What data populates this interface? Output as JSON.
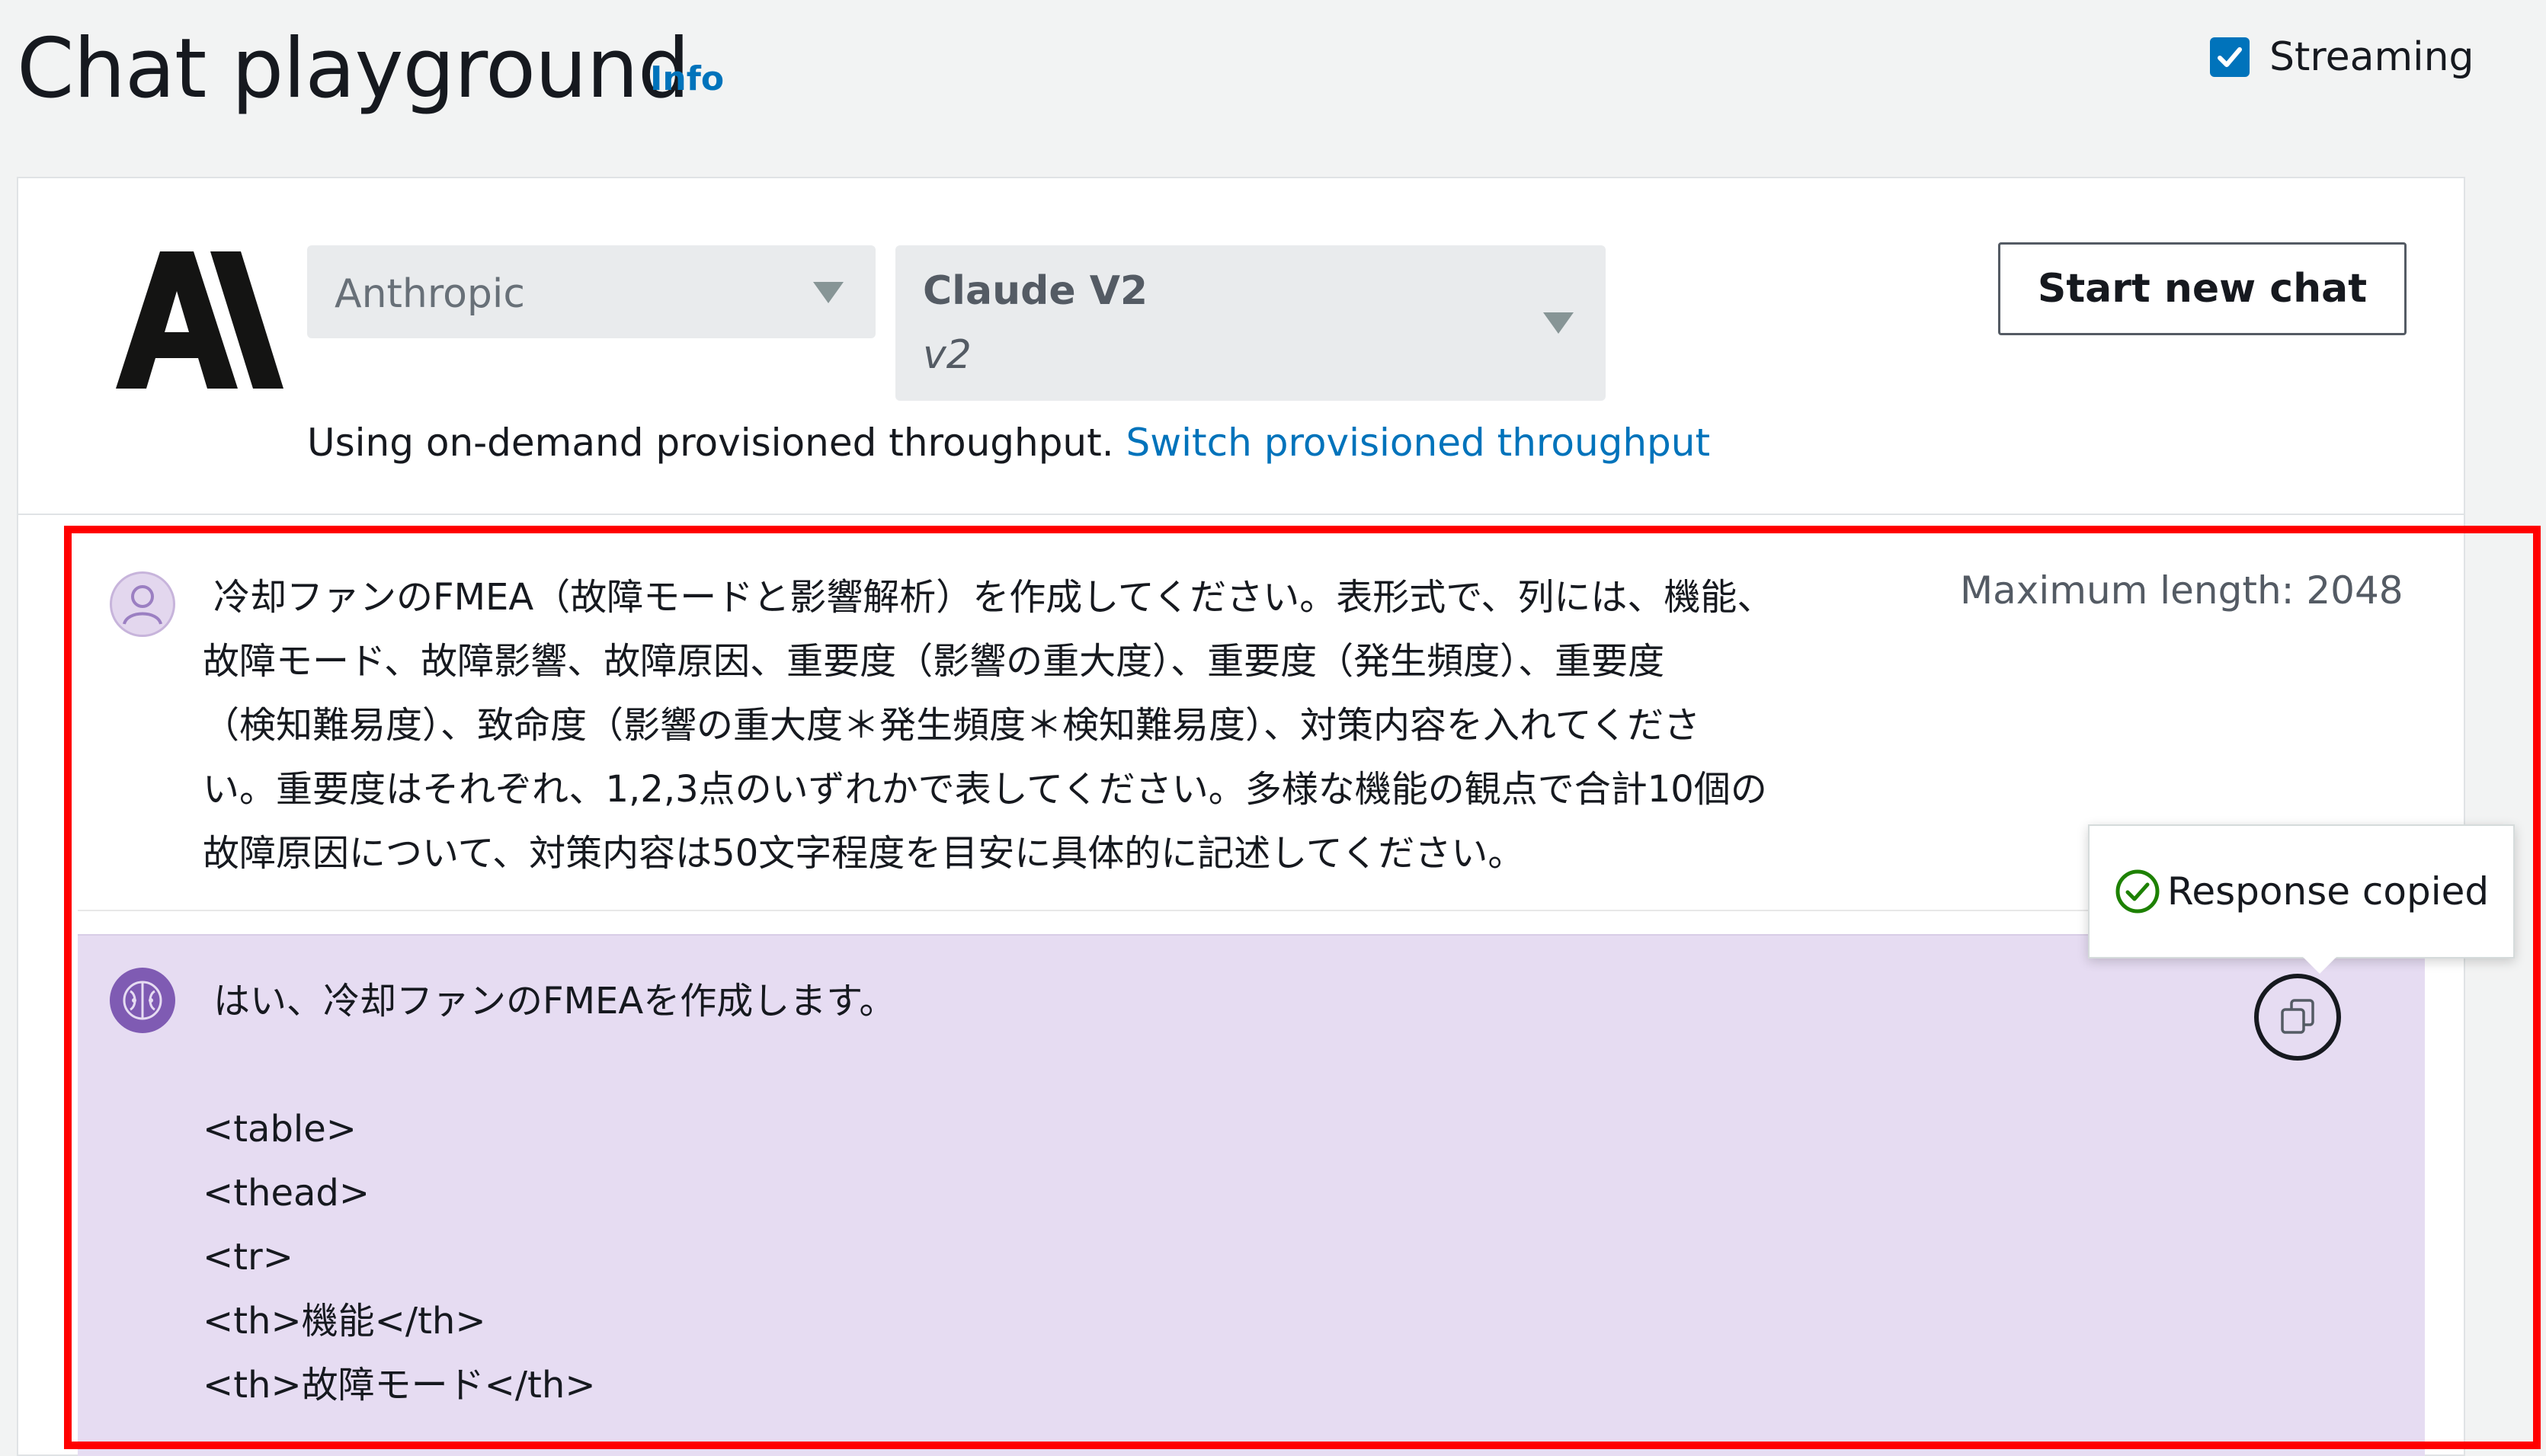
{
  "header": {
    "title": "Chat playground",
    "info_link": "Info",
    "streaming_label": "Streaming",
    "streaming_checked": true
  },
  "config": {
    "provider_logo": "anthropic-logo",
    "provider_select": "Anthropic",
    "model_select": "Claude V2",
    "model_version": "v2",
    "start_new_chat": "Start new chat",
    "throughput_text": "Using on-demand provisioned throughput. ",
    "throughput_link": "Switch provisioned throughput"
  },
  "chat": {
    "user_message_lines": [
      "冷却ファンのFMEA（故障モードと影響解析）を作成してください。表形式で、列には、機能、",
      "故障モード、故障影響、故障原因、重要度（影響の重大度）、重要度（発生頻度）、重要度",
      "（検知難易度）、致命度（影響の重大度＊発生頻度＊検知難易度）、対策内容を入れてくださ",
      "い。重要度はそれぞれ、1,2,3点のいずれかで表してください。多様な機能の観点で合計10個の",
      "故障原因について、対策内容は50文字程度を目安に具体的に記述してください。"
    ],
    "max_length": "Maximum length: 2048",
    "bot_message_lines": [
      "はい、冷却ファンのFMEAを作成します。",
      "",
      "<table>",
      "<thead>",
      "<tr>",
      "<th>機能</th>",
      "<th>故障モード</th>"
    ],
    "copy_tooltip": "Response copied"
  },
  "colors": {
    "accent": "#0073bb",
    "bot_bubble": "#e6dcf2",
    "highlight": "#ff0000"
  }
}
